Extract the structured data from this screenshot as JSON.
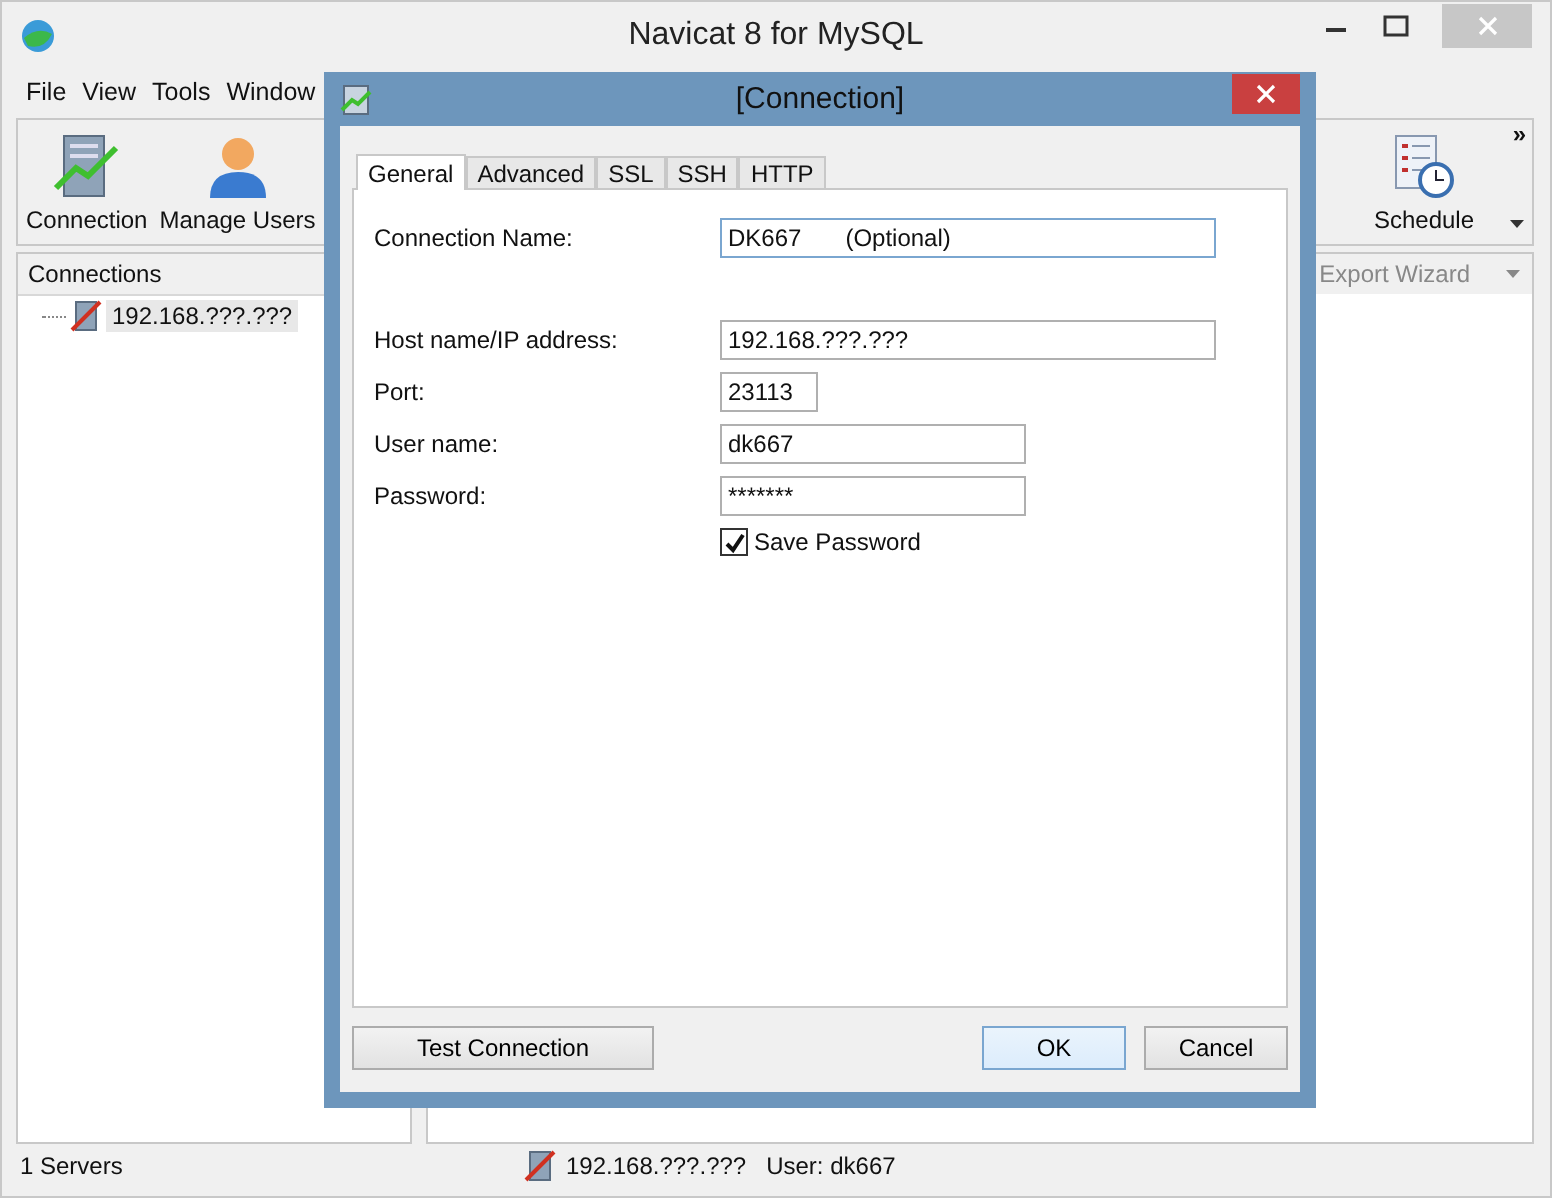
{
  "window": {
    "title": "Navicat 8 for MySQL"
  },
  "menu": [
    "File",
    "View",
    "Tools",
    "Window"
  ],
  "toolbar": [
    {
      "label": "Connection",
      "kind": "connection"
    },
    {
      "label": "Manage Users",
      "kind": "users"
    },
    {
      "label": "Schedule",
      "kind": "schedule"
    }
  ],
  "toolbar_overflow": "»",
  "export_wizard": "Export Wizard",
  "connections": {
    "title": "Connections",
    "items": [
      {
        "label": "192.168.???.???",
        "selected": true
      }
    ]
  },
  "status_bar": {
    "servers": "1 Servers",
    "host": "192.168.???.???",
    "user": "User: dk667"
  },
  "dialog": {
    "title": "[Connection]",
    "tabs": [
      {
        "label": "General",
        "selected": true
      },
      {
        "label": "Advanced",
        "selected": false
      },
      {
        "label": "SSL",
        "selected": false
      },
      {
        "label": "SSH",
        "selected": false
      },
      {
        "label": "HTTP",
        "selected": false
      }
    ],
    "fields": [
      {
        "label": "Connection Name:",
        "value": "DK667",
        "hint": "(Optional)",
        "kind": "wide"
      },
      {
        "label": "Host name/IP address:",
        "value": "192.168.???.???",
        "kind": "wide"
      },
      {
        "label": "Port:",
        "value": "23113",
        "kind": "short"
      },
      {
        "label": "User name:",
        "value": "dk667",
        "kind": "medium"
      },
      {
        "label": "Password:",
        "value": "*******",
        "kind": "medium"
      }
    ],
    "save_password": {
      "label": "Save Password",
      "checked": true
    },
    "buttons": [
      {
        "label": "Test Connection",
        "default": false
      },
      {
        "label": "OK",
        "default": true
      },
      {
        "label": "Cancel",
        "default": false
      }
    ]
  }
}
